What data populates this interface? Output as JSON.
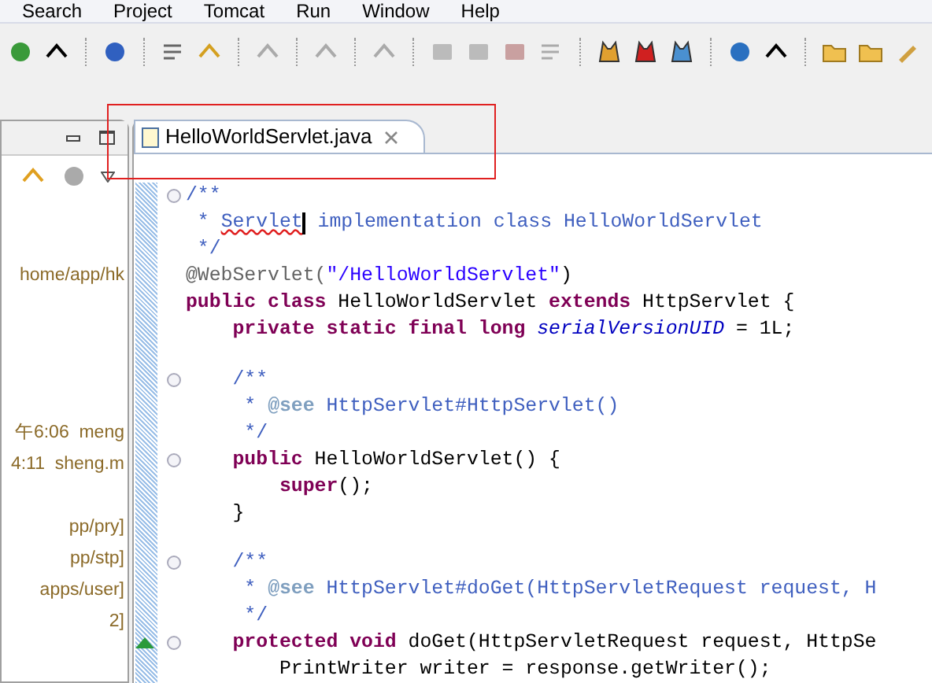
{
  "menu": [
    "Search",
    "Project",
    "Tomcat",
    "Run",
    "Window",
    "Help"
  ],
  "left_panel": {
    "lines": [
      "home/app/hk",
      "午6:06  meng",
      "4:11  sheng.m",
      "pp/pry]",
      "pp/stp]",
      "apps/user]",
      "2]"
    ]
  },
  "editor_tabs": [
    {
      "label": "HelloWorldServlet.java",
      "selected": true
    }
  ],
  "code": [
    {
      "fold": true,
      "marker": false,
      "tokens": [
        {
          "kind": "comment",
          "text": "/**"
        }
      ]
    },
    {
      "fold": false,
      "marker": false,
      "tokens": [
        {
          "kind": "comment",
          "text": " * "
        },
        {
          "kind": "misspelled",
          "text": "Servlet"
        },
        {
          "kind": "cursor"
        },
        {
          "kind": "comment",
          "text": " implementation class HelloWorldServlet"
        }
      ]
    },
    {
      "fold": false,
      "marker": false,
      "tokens": [
        {
          "kind": "comment",
          "text": " */"
        }
      ]
    },
    {
      "fold": false,
      "marker": false,
      "tokens": [
        {
          "kind": "annotation",
          "text": "@WebServlet("
        },
        {
          "kind": "string",
          "text": "\"/HelloWorldServlet\""
        },
        {
          "kind": "plain",
          "text": ")"
        }
      ]
    },
    {
      "fold": false,
      "marker": false,
      "tokens": [
        {
          "kind": "keyword",
          "text": "public class "
        },
        {
          "kind": "plain",
          "text": "HelloWorldServlet "
        },
        {
          "kind": "keyword",
          "text": "extends "
        },
        {
          "kind": "plain",
          "text": "HttpServlet {"
        }
      ]
    },
    {
      "fold": false,
      "marker": false,
      "tokens": [
        {
          "kind": "keyword",
          "text": "    private static final long "
        },
        {
          "kind": "field",
          "text": "serialVersionUID"
        },
        {
          "kind": "plain",
          "text": " = 1L;"
        }
      ]
    },
    {
      "fold": false,
      "marker": false
    },
    {
      "fold": true,
      "marker": false,
      "tokens": [
        {
          "kind": "comment",
          "text": "    /**"
        }
      ]
    },
    {
      "fold": false,
      "marker": false,
      "tokens": [
        {
          "kind": "comment",
          "text": "     * "
        },
        {
          "kind": "doctag",
          "text": "@see"
        },
        {
          "kind": "comment",
          "text": " HttpServlet#HttpServlet()"
        }
      ]
    },
    {
      "fold": false,
      "marker": false,
      "tokens": [
        {
          "kind": "comment",
          "text": "     */"
        }
      ]
    },
    {
      "fold": true,
      "marker": false,
      "tokens": [
        {
          "kind": "keyword",
          "text": "    public "
        },
        {
          "kind": "plain",
          "text": "HelloWorldServlet() {"
        }
      ]
    },
    {
      "fold": false,
      "marker": false,
      "tokens": [
        {
          "kind": "keyword",
          "text": "        super"
        },
        {
          "kind": "plain",
          "text": "();"
        }
      ]
    },
    {
      "fold": false,
      "marker": false,
      "tokens": [
        {
          "kind": "plain",
          "text": "    }"
        }
      ]
    },
    {
      "fold": false,
      "marker": false
    },
    {
      "fold": true,
      "marker": false,
      "tokens": [
        {
          "kind": "comment",
          "text": "    /**"
        }
      ]
    },
    {
      "fold": false,
      "marker": false,
      "tokens": [
        {
          "kind": "comment",
          "text": "     * "
        },
        {
          "kind": "doctag",
          "text": "@see"
        },
        {
          "kind": "comment",
          "text": " HttpServlet#doGet(HttpServletRequest request, H"
        }
      ]
    },
    {
      "fold": false,
      "marker": false,
      "tokens": [
        {
          "kind": "comment",
          "text": "     */"
        }
      ]
    },
    {
      "fold": true,
      "marker": true,
      "tokens": [
        {
          "kind": "keyword",
          "text": "    protected void "
        },
        {
          "kind": "plain",
          "text": "doGet(HttpServletRequest request, HttpSe"
        }
      ]
    },
    {
      "fold": false,
      "marker": false,
      "tokens": [
        {
          "kind": "plain",
          "text": "        PrintWriter writer = response.getWriter();"
        }
      ]
    }
  ]
}
